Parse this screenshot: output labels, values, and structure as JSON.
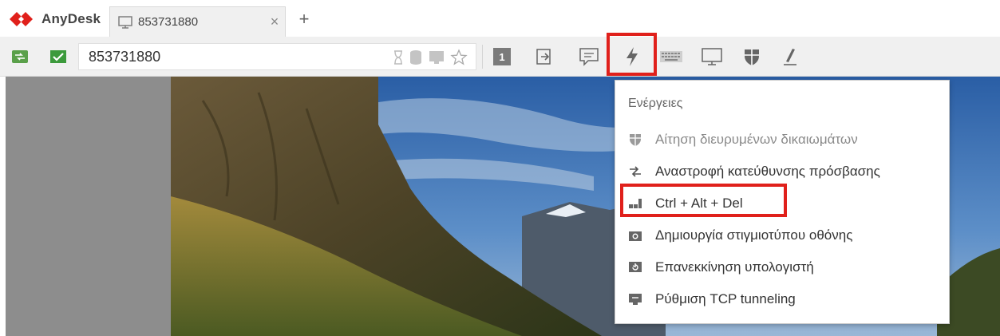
{
  "app": {
    "brand_name": "AnyDesk",
    "accent_color": "#e0201b"
  },
  "tab": {
    "label": "853731880",
    "close_glyph": "×",
    "new_tab_glyph": "+"
  },
  "toolbar": {
    "address_value": "853731880",
    "display_number": "1",
    "icons": [
      "connection-status-icon",
      "verified-icon",
      "hourglass-icon",
      "database-icon",
      "monitor-icon",
      "favorite-star-icon",
      "display-1-icon",
      "file-transfer-icon",
      "chat-icon",
      "actions-lightning-icon",
      "keyboard-icon",
      "display-icon",
      "permissions-shield-icon",
      "whiteboard-pen-icon"
    ]
  },
  "menu": {
    "title": "Ενέργειες",
    "items": [
      {
        "label": "Αίτηση διευρυμένων δικαιωμάτων",
        "icon": "shield-icon",
        "disabled": true
      },
      {
        "label": "Αναστροφή κατεύθυνσης πρόσβασης",
        "icon": "switch-direction-icon",
        "disabled": false
      },
      {
        "label": "Ctrl + Alt + Del",
        "icon": "ctrl-alt-del-icon",
        "disabled": false
      },
      {
        "label": "Δημιουργία στιγμιοτύπου οθόνης",
        "icon": "camera-icon",
        "disabled": false
      },
      {
        "label": "Επανεκκίνηση υπολογιστή",
        "icon": "restart-icon",
        "disabled": false
      },
      {
        "label": "Ρύθμιση TCP tunneling",
        "icon": "tcp-tunnel-icon",
        "disabled": false
      }
    ]
  }
}
